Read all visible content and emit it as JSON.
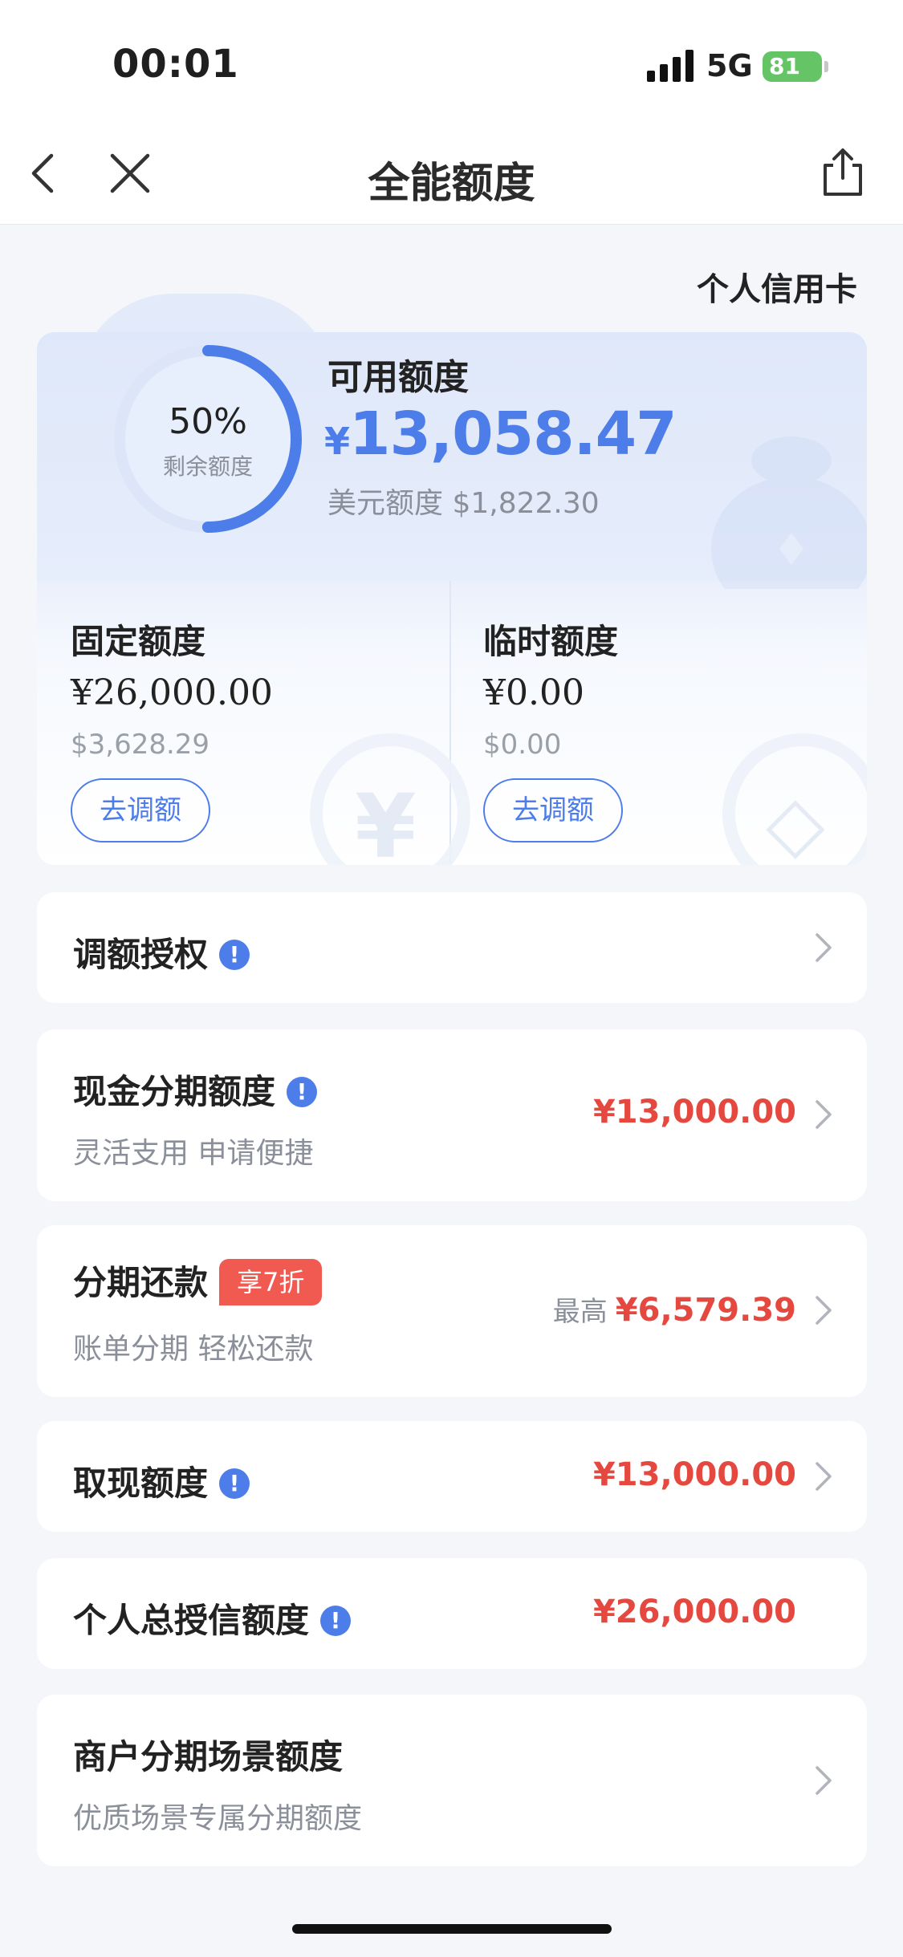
{
  "status_bar": {
    "time": "00:01",
    "network": "5G",
    "battery": "81"
  },
  "nav": {
    "title": "全能额度"
  },
  "card_type": "个人信用卡",
  "summary": {
    "ring_percent": "50%",
    "ring_label": "剩余额度",
    "ring_fraction": 0.5,
    "available_label": "可用额度",
    "currency_symbol": "¥",
    "available_amount": "13,058.47",
    "usd_label": "美元额度",
    "usd_amount": "$1,822.30"
  },
  "fixed_limit": {
    "label": "固定额度",
    "amount": "¥26,000.00",
    "usd": "$3,628.29",
    "button": "去调额"
  },
  "temp_limit": {
    "label": "临时额度",
    "amount": "¥0.00",
    "usd": "$0.00",
    "button": "去调额"
  },
  "rows": {
    "authorization": {
      "title": "调额授权",
      "info": "!"
    },
    "cash_installment": {
      "title": "现金分期额度",
      "info": "!",
      "subtitle": "灵活支用 申请便捷",
      "value": "¥13,000.00"
    },
    "bill_installment": {
      "title": "分期还款",
      "badge": "享7折",
      "subtitle": "账单分期 轻松还款",
      "prefix": "最高",
      "value": "¥6,579.39"
    },
    "cash_withdrawal": {
      "title": "取现额度",
      "info": "!",
      "value": "¥13,000.00"
    },
    "total_credit": {
      "title": "个人总授信额度",
      "info": "!",
      "value": "¥26,000.00"
    },
    "merchant": {
      "title": "商户分期场景额度",
      "subtitle": "优质场景专属分期额度"
    }
  },
  "colors": {
    "accent": "#4d7de9",
    "amount_red": "#e5483f",
    "battery_green": "#65c466"
  }
}
